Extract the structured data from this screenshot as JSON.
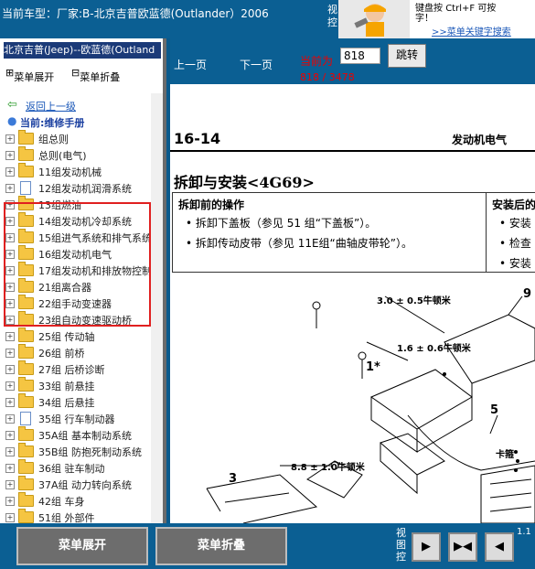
{
  "top": {
    "title": "当前车型：厂家:B-北京吉普欧蓝德(Outlander）2006",
    "video_ctrl": "视\n控",
    "tip_line1": "键盘按",
    "tip_keys": "Ctrl+F  可按",
    "tip_line2": "字！",
    "tip_link": ">>菜单关键字搜索"
  },
  "left": {
    "header": "北京吉普(Jeep)--欧蓝德(Outland",
    "expand_all": "菜单展开",
    "collapse_all": "菜单折叠",
    "back": "返回上一级",
    "current": "当前:维修手册",
    "items": [
      {
        "label": "组总则",
        "type": "folder"
      },
      {
        "label": "总则(电气)",
        "type": "folder"
      },
      {
        "label": "11组发动机械",
        "type": "folder"
      },
      {
        "label": "12组发动机润滑系统",
        "type": "doc"
      },
      {
        "label": "13组燃油",
        "type": "folder"
      },
      {
        "label": "14组发动机冷却系统",
        "type": "folder"
      },
      {
        "label": "15组进气系统和排气系统",
        "type": "folder"
      },
      {
        "label": "16组发动机电气",
        "type": "folder"
      },
      {
        "label": "17组发动机和排放物控制",
        "type": "folder"
      },
      {
        "label": "21组离合器",
        "type": "folder"
      },
      {
        "label": "22组手动变速器",
        "type": "folder"
      },
      {
        "label": "23组自动变速驱动桥",
        "type": "folder"
      },
      {
        "label": "25组 传动轴",
        "type": "folder"
      },
      {
        "label": "26组 前桥",
        "type": "folder"
      },
      {
        "label": "27组 后桥诊断",
        "type": "folder"
      },
      {
        "label": "33组 前悬挂",
        "type": "folder"
      },
      {
        "label": "34组 后悬挂",
        "type": "folder"
      },
      {
        "label": "35组 行车制动器",
        "type": "doc"
      },
      {
        "label": "35A组 基本制动系统",
        "type": "folder"
      },
      {
        "label": "35B组 防抱死制动系统",
        "type": "folder"
      },
      {
        "label": "36组 驻车制动",
        "type": "folder"
      },
      {
        "label": "37A组 动力转向系统",
        "type": "folder"
      },
      {
        "label": "42组 车身",
        "type": "folder"
      },
      {
        "label": "51组 外部件",
        "type": "folder"
      }
    ]
  },
  "doc": {
    "prev": "上一页",
    "next": "下一页",
    "current_label": "当前为",
    "current_value": "818",
    "jump": "跳转",
    "page_count": "818 / 3478",
    "section_no": "16-14",
    "section_name": "发动机电气",
    "title": "拆卸与安装<4G69>",
    "table": {
      "left_head": "拆卸前的操作",
      "left_items": [
        "•  拆卸下盖板（参见 51 组“下盖板”）。",
        "•  拆卸传动皮带（参见 11E组“曲轴皮带轮”）。"
      ],
      "right_head": "安装后的",
      "right_items": [
        "•  安装",
        "•  检查",
        "•  安装"
      ]
    },
    "diagram": {
      "t1": "3.0 ± 0.5牛顿米",
      "t2": "1.6 ± 0.6牛顿米",
      "t3": "8.8 ± 1.0牛顿米",
      "n1": "1*",
      "n3": "3",
      "n5": "5",
      "n9": "9",
      "clip": "卡箍"
    }
  },
  "bottom": {
    "expand": "菜单展开",
    "collapse": "菜单折叠",
    "view": "视\n图\n控",
    "corner": "1.1"
  }
}
